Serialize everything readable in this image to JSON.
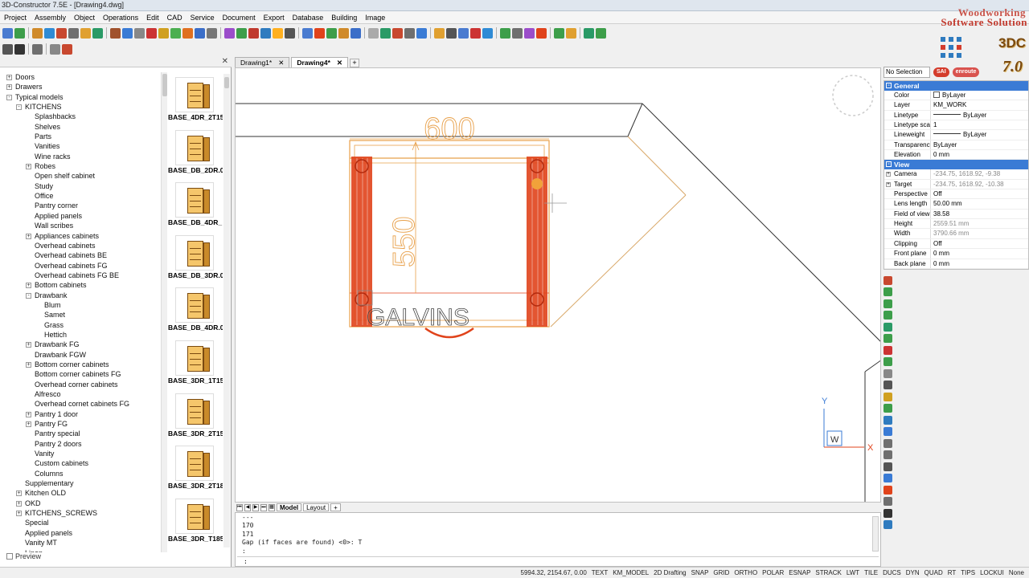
{
  "app": {
    "title": "3D-Constructor 7.5E - [Drawing4.dwg]"
  },
  "brand": {
    "line1": "Woodworking",
    "line2": "Software Solution",
    "badge": "3DC",
    "version": "7.0",
    "sai": "SAI",
    "enroute": "enroute"
  },
  "menu": [
    "Project",
    "Assembly",
    "Object",
    "Operations",
    "Edit",
    "CAD",
    "Service",
    "Document",
    "Export",
    "Database",
    "Building",
    "Image"
  ],
  "tree": [
    {
      "label": "Doors",
      "indent": 0,
      "exp": "+"
    },
    {
      "label": "Drawers",
      "indent": 0,
      "exp": "+"
    },
    {
      "label": "Typical models",
      "indent": 0,
      "exp": "-"
    },
    {
      "label": "KITCHENS",
      "indent": 1,
      "exp": "-"
    },
    {
      "label": "Splashbacks",
      "indent": 2,
      "exp": ""
    },
    {
      "label": "Shelves",
      "indent": 2,
      "exp": ""
    },
    {
      "label": "Parts",
      "indent": 2,
      "exp": ""
    },
    {
      "label": "Vanities",
      "indent": 2,
      "exp": ""
    },
    {
      "label": "Wine racks",
      "indent": 2,
      "exp": ""
    },
    {
      "label": "Robes",
      "indent": 2,
      "exp": "+"
    },
    {
      "label": "Open shelf cabinet",
      "indent": 2,
      "exp": ""
    },
    {
      "label": "Study",
      "indent": 2,
      "exp": ""
    },
    {
      "label": "Office",
      "indent": 2,
      "exp": ""
    },
    {
      "label": "Pantry corner",
      "indent": 2,
      "exp": ""
    },
    {
      "label": "Applied panels",
      "indent": 2,
      "exp": ""
    },
    {
      "label": "Wall scribes",
      "indent": 2,
      "exp": ""
    },
    {
      "label": "Appliances cabinets",
      "indent": 2,
      "exp": "+"
    },
    {
      "label": "Overhead cabinets",
      "indent": 2,
      "exp": ""
    },
    {
      "label": "Overhead cabinets BE",
      "indent": 2,
      "exp": ""
    },
    {
      "label": "Overhead cabinets FG",
      "indent": 2,
      "exp": ""
    },
    {
      "label": "Overhead cabinets FG BE",
      "indent": 2,
      "exp": ""
    },
    {
      "label": "Bottom cabinets",
      "indent": 2,
      "exp": "+"
    },
    {
      "label": "Drawbank",
      "indent": 2,
      "exp": "-"
    },
    {
      "label": "Blum",
      "indent": 3,
      "exp": ""
    },
    {
      "label": "Samet",
      "indent": 3,
      "exp": ""
    },
    {
      "label": "Grass",
      "indent": 3,
      "exp": ""
    },
    {
      "label": "Hettich",
      "indent": 3,
      "exp": ""
    },
    {
      "label": "Drawbank FG",
      "indent": 2,
      "exp": "+"
    },
    {
      "label": "Drawbank FGW",
      "indent": 2,
      "exp": ""
    },
    {
      "label": "Bottom corner cabinets",
      "indent": 2,
      "exp": "+"
    },
    {
      "label": "Bottom corner cabinets FG",
      "indent": 2,
      "exp": ""
    },
    {
      "label": "Overhead corner cabinets",
      "indent": 2,
      "exp": ""
    },
    {
      "label": "Alfresco",
      "indent": 2,
      "exp": ""
    },
    {
      "label": "Overhead cornet cabinets FG",
      "indent": 2,
      "exp": ""
    },
    {
      "label": "Pantry 1 door",
      "indent": 2,
      "exp": "+"
    },
    {
      "label": "Pantry FG",
      "indent": 2,
      "exp": "+"
    },
    {
      "label": "Pantry special",
      "indent": 2,
      "exp": ""
    },
    {
      "label": "Pantry 2 doors",
      "indent": 2,
      "exp": ""
    },
    {
      "label": "Vanity",
      "indent": 2,
      "exp": ""
    },
    {
      "label": "Custom cabinets",
      "indent": 2,
      "exp": ""
    },
    {
      "label": "Columns",
      "indent": 2,
      "exp": ""
    },
    {
      "label": "Supplementary",
      "indent": 1,
      "exp": ""
    },
    {
      "label": "Kitchen OLD",
      "indent": 1,
      "exp": "+"
    },
    {
      "label": "OKD",
      "indent": 1,
      "exp": "+"
    },
    {
      "label": "KITCHENS_SCREWS",
      "indent": 1,
      "exp": "+"
    },
    {
      "label": "Special",
      "indent": 1,
      "exp": ""
    },
    {
      "label": "Applied panels",
      "indent": 1,
      "exp": ""
    },
    {
      "label": "Vanity MT",
      "indent": 1,
      "exp": ""
    },
    {
      "label": "Linen",
      "indent": 1,
      "exp": ""
    }
  ],
  "thumbnails": [
    "BASE_4DR_2T15",
    "BASE_DB_2DR.0",
    "BASE_DB_4DR_",
    "BASE_DB_3DR.0",
    "BASE_DB_4DR.0",
    "BASE_3DR_1T15",
    "BASE_3DR_2T15",
    "BASE_3DR_2T18",
    "BASE_3DR_T185"
  ],
  "preview": "Preview",
  "tabs": [
    {
      "label": "Drawing1*",
      "active": false
    },
    {
      "label": "Drawing4*",
      "active": true
    }
  ],
  "tab_add": "+",
  "drawing": {
    "dim_width": "600",
    "dim_height": "550",
    "brand_text": "GALVINS",
    "ucs_y": "Y",
    "ucs_w": "W",
    "ucs_x": "X"
  },
  "layout_tabs": [
    {
      "label": "Model",
      "active": true
    },
    {
      "label": "Layout",
      "active": false
    }
  ],
  "layout_add": "+",
  "command_lines": [
    "---",
    "170",
    "171",
    "Gap (if faces are found) <0>: T",
    ":"
  ],
  "command_prompt": ":",
  "status": {
    "coords": "5994.32, 2154.67, 0.00",
    "items": [
      "TEXT",
      "KM_MODEL",
      "2D Drafting",
      "SNAP",
      "GRID",
      "ORTHO",
      "POLAR",
      "ESNAP",
      "STRACK",
      "LWT",
      "TILE",
      "DUCS",
      "DYN",
      "QUAD",
      "RT",
      "TIPS",
      "LOCKUI",
      "None"
    ]
  },
  "properties": {
    "selection": "No Selection",
    "general_label": "General",
    "general": [
      {
        "key": "Color",
        "value": "ByLayer",
        "kind": "swatch"
      },
      {
        "key": "Layer",
        "value": "KM_WORK",
        "kind": "text"
      },
      {
        "key": "Linetype",
        "value": "ByLayer",
        "kind": "line"
      },
      {
        "key": "Linetype scale",
        "value": "1",
        "kind": "text"
      },
      {
        "key": "Lineweight",
        "value": "ByLayer",
        "kind": "line"
      },
      {
        "key": "Transparency",
        "value": "ByLayer",
        "kind": "text"
      },
      {
        "key": "Elevation",
        "value": "0 mm",
        "kind": "text"
      }
    ],
    "view_label": "View",
    "view": [
      {
        "key": "Camera",
        "value": "-234.75, 1618.92, -9.38",
        "gray": true,
        "exp": true
      },
      {
        "key": "Target",
        "value": "-234.75, 1618.92, -10.38",
        "gray": true,
        "exp": true
      },
      {
        "key": "Perspective",
        "value": "Off",
        "gray": false
      },
      {
        "key": "Lens length",
        "value": "50.00 mm",
        "gray": false
      },
      {
        "key": "Field of view",
        "value": "38.58",
        "gray": false
      },
      {
        "key": "Height",
        "value": "2559.51 mm",
        "gray": true
      },
      {
        "key": "Width",
        "value": "3790.66 mm",
        "gray": true
      },
      {
        "key": "Clipping",
        "value": "Off",
        "gray": false
      },
      {
        "key": "Front plane",
        "value": "0 mm",
        "gray": false
      },
      {
        "key": "Back plane",
        "value": "0 mm",
        "gray": false
      }
    ]
  },
  "colors": {
    "accent": "#3a7bd5",
    "cabinet": "#e0431b",
    "dimension": "#e8a04a",
    "brand": "#c23a2e"
  }
}
